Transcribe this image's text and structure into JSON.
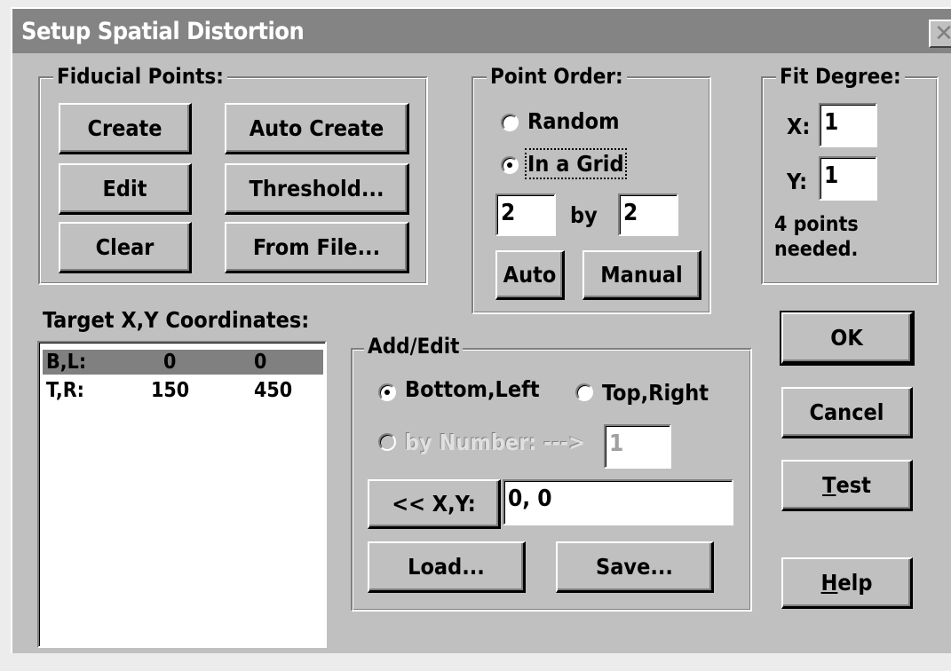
{
  "window": {
    "title": "Setup Spatial Distortion",
    "close_glyph": "✕"
  },
  "fiducial": {
    "legend": "Fiducial Points:",
    "create": "Create",
    "auto_create": "Auto Create",
    "edit": "Edit",
    "threshold": "Threshold...",
    "clear": "Clear",
    "from_file": "From File..."
  },
  "point_order": {
    "legend": "Point Order:",
    "random": "Random",
    "in_a_grid": "In a Grid",
    "selected": "In a Grid",
    "rows": "2",
    "by": "by",
    "cols": "2",
    "auto": "Auto",
    "manual": "Manual"
  },
  "fit_degree": {
    "legend": "Fit Degree:",
    "x_label": "X:",
    "x_value": "1",
    "y_label": "Y:",
    "y_value": "1",
    "note_line1": "4 points",
    "note_line2": "needed."
  },
  "target": {
    "label": "Target X,Y Coordinates:",
    "rows": [
      {
        "name": "B,L:",
        "x": "0",
        "y": "0",
        "selected": true
      },
      {
        "name": "T,R:",
        "x": "150",
        "y": "450",
        "selected": false
      }
    ]
  },
  "add_edit": {
    "legend": "Add/Edit",
    "bottom_left": "Bottom,Left",
    "top_right": "Top,Right",
    "selected": "Bottom,Left",
    "by_number": "by Number: --->",
    "number_value": "1",
    "xy_button": "<< X,Y:",
    "xy_value": "0, 0",
    "load": "Load...",
    "save": "Save..."
  },
  "actions": {
    "ok": "OK",
    "cancel": "Cancel",
    "test_mnemonic": "T",
    "test_rest": "est",
    "help_mnemonic": "H",
    "help_rest": "elp"
  },
  "colors": {
    "face": "#c0c0c0",
    "title_inactive": "#848484",
    "shadow": "#808080",
    "highlight": "#ffffff"
  }
}
